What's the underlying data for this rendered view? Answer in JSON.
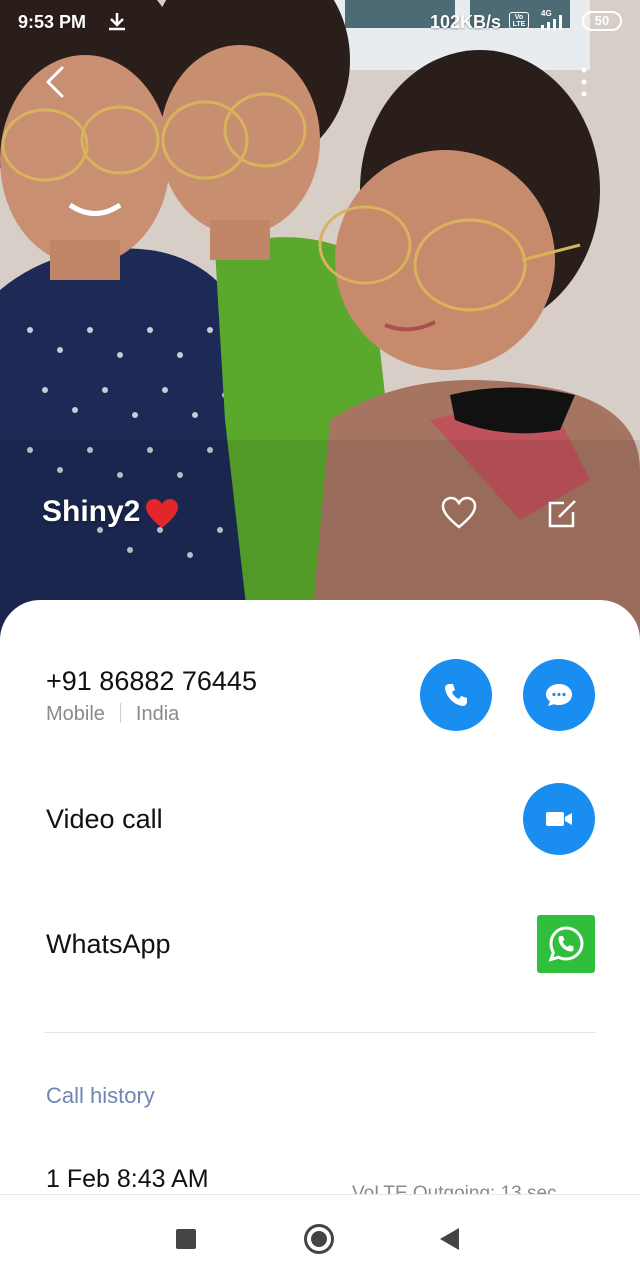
{
  "status_bar": {
    "time": "9:53 PM",
    "download_icon": "download-arrow-icon",
    "net_speed": "102KB/s",
    "volte": "Vo LTE",
    "network": "4G",
    "battery": "50"
  },
  "header": {
    "contact_name": "Shiny2",
    "name_emoji": "red-heart",
    "back_icon": "chevron-left-icon",
    "more_icon": "more-vertical-icon",
    "favorite_icon": "heart-outline-icon",
    "edit_icon": "edit-icon"
  },
  "phone": {
    "number": "+91 86882 76445",
    "type": "Mobile",
    "location": "India"
  },
  "actions": {
    "video_call_label": "Video call",
    "whatsapp_label": "WhatsApp"
  },
  "call_history": {
    "title": "Call history",
    "entries": [
      {
        "date": "1 Feb 8:43 AM",
        "detail": "VoLTE  Outgoing: 13 sec"
      }
    ]
  },
  "colors": {
    "accent": "#1a8ef0",
    "whatsapp": "#2fbf3d",
    "section_title": "#6f86b0"
  }
}
